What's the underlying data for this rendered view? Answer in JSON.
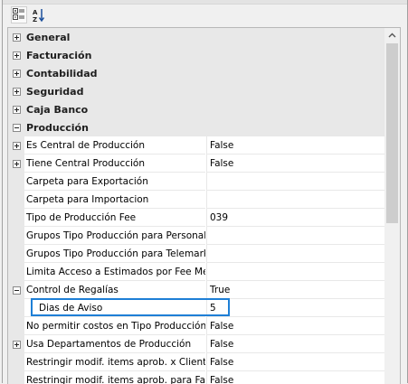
{
  "toolbar": {
    "categorized_icon": "categorized-view-icon",
    "alphabetical_icon": "alphabetical-sort-icon"
  },
  "categories_collapsed": [
    "General",
    "Facturación",
    "Contabilidad",
    "Seguridad",
    "Caja Banco"
  ],
  "expanded_category": "Producción",
  "properties": [
    {
      "name": "Es Central de Producción",
      "value": "False",
      "expander": "plus"
    },
    {
      "name": "Tiene Central Producción",
      "value": "False",
      "expander": "plus"
    },
    {
      "name": "Carpeta para Exportación",
      "value": ""
    },
    {
      "name": "Carpeta para Importacion",
      "value": ""
    },
    {
      "name": "Tipo de Producción Fee",
      "value": "039"
    },
    {
      "name": "Grupos Tipo Producción para Personal",
      "value": ""
    },
    {
      "name": "Grupos Tipo Producción para Telemarketing",
      "value": ""
    },
    {
      "name": "Limita Acceso a Estimados por Fee Mensual",
      "value": ""
    },
    {
      "name": "Control de Regalías",
      "value": "True",
      "expander": "minus"
    },
    {
      "name": "Dias de Aviso",
      "value": "5",
      "child": true,
      "selected": true
    },
    {
      "name": "No permitir costos en Tipo Producción Honorarios",
      "value": "False"
    },
    {
      "name": "Usa Departamentos de Producción",
      "value": "False",
      "expander": "plus"
    },
    {
      "name": "Restringir modif. items aprob. x Cliente",
      "value": "False"
    },
    {
      "name": "Restringir modif. items aprob. para Facturar",
      "value": "False"
    }
  ]
}
